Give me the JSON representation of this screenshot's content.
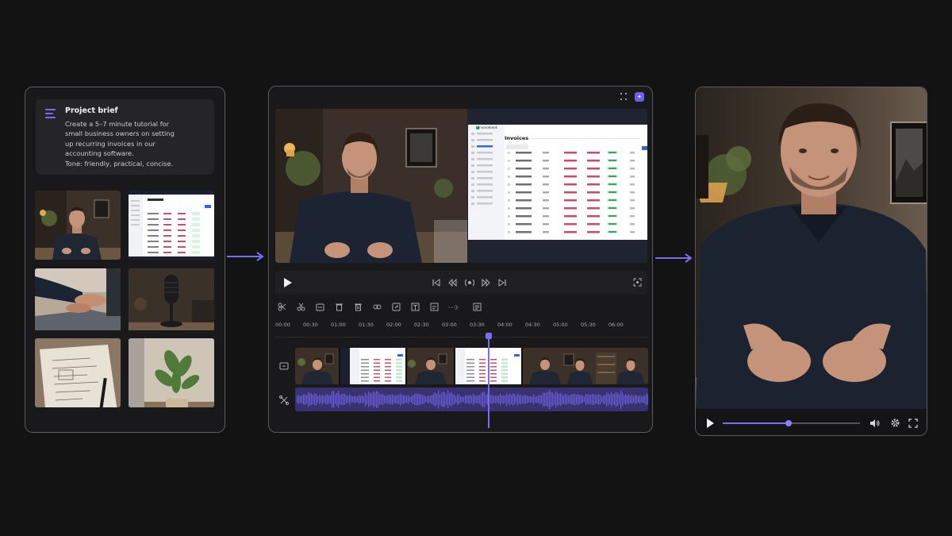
{
  "brief": {
    "title": "Project brief",
    "lines": [
      "Create a 5–7 minute tutorial for",
      "small business owners on setting",
      "up recurring invoices in our",
      "accounting software.",
      "Tone: friendly, practical, concise."
    ]
  },
  "assets": [
    {
      "name": "asset-presenter-thumb",
      "icon": "presenter"
    },
    {
      "name": "asset-invoices-screen-thumb",
      "icon": "screen"
    },
    {
      "name": "asset-typing-laptop-thumb",
      "icon": "laptop"
    },
    {
      "name": "asset-microphone-thumb",
      "icon": "microphone"
    },
    {
      "name": "asset-notebook-thumb",
      "icon": "notebook"
    },
    {
      "name": "asset-plant-thumb",
      "icon": "plant"
    }
  ],
  "editor": {
    "app_screen": {
      "brand": "Invoicebook",
      "title": "Invoices",
      "sidebar": [
        "Dashboard",
        "Transactions",
        "Invoices",
        "Payments",
        "Customers",
        "Products",
        "Reports",
        "Banking",
        "Taxes",
        "Payroll",
        "Expenses",
        "Settings"
      ]
    },
    "timeline_marks": [
      "00:00",
      "00:30",
      "01:00",
      "01:30",
      "02:00",
      "02:30",
      "03:00",
      "03:30",
      "04:00",
      "04:30",
      "05:00",
      "05:30",
      "06:00"
    ],
    "playhead_time": "03:30",
    "tools": [
      "scissors-icon",
      "cut-icon",
      "caption-icon",
      "trash-icon",
      "trash-alt-icon",
      "link-icon",
      "export-icon",
      "text-icon",
      "subtitle-icon",
      "transition-icon",
      "notes-icon"
    ]
  },
  "player": {
    "progress": 0.48
  },
  "colors": {
    "accent": "#7b6cf6",
    "background": "#131314",
    "panel": "#19191b",
    "audio": "#6a5bd8"
  }
}
